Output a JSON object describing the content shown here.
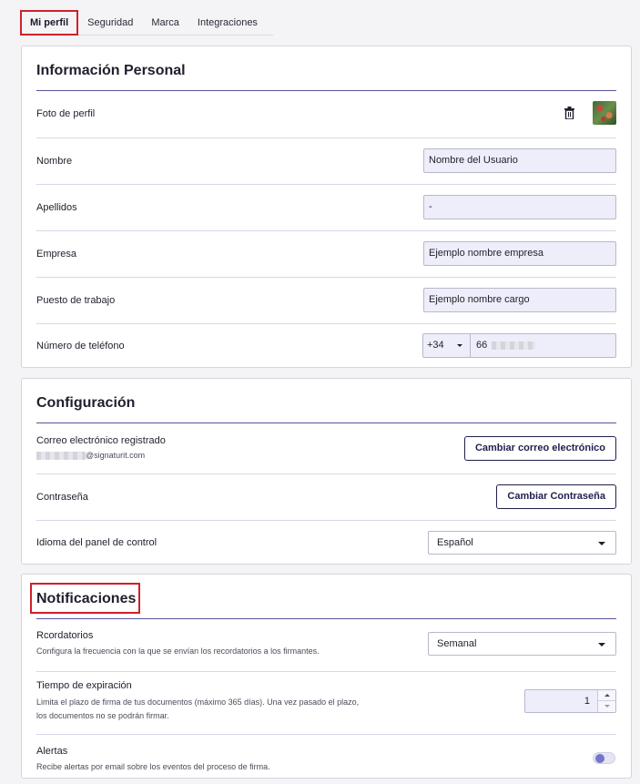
{
  "tabs": [
    "Mi perfil",
    "Seguridad",
    "Marca",
    "Integraciones"
  ],
  "personal": {
    "title": "Información Personal",
    "photo_label": "Foto de perfil",
    "name_label": "Nombre",
    "name_value": "Nombre del Usuario",
    "surname_label": "Apellidos",
    "surname_value": "-",
    "company_label": "Empresa",
    "company_value": "Ejemplo nombre empresa",
    "job_label": "Puesto de trabajo",
    "job_value": "Ejemplo nombre cargo",
    "phone_label": "Número de teléfono",
    "phone_prefix": "+34",
    "phone_value": "66"
  },
  "config": {
    "title": "Configuración",
    "email_label": "Correo electrónico registrado",
    "email_domain": "@signaturit.com",
    "email_button": "Cambiar correo electrónico",
    "password_label": "Contraseña",
    "password_button": "Cambiar Contraseña",
    "language_label": "Idioma del panel de control",
    "language_value": "Español"
  },
  "notifications": {
    "title": "Notificaciones",
    "reminders_label": "Rcordatorios",
    "reminders_desc": "Configura la frecuencia con la que se envían los recordatorios a los firmantes.",
    "reminders_value": "Semanal",
    "expiration_label": "Tiempo de expiración",
    "expiration_desc_1": "Limita el plazo de firma de tus documentos (máximo 365 días). Una vez pasado el plazo,",
    "expiration_desc_2": "los documentos no se podrán firmar.",
    "expiration_value": "1",
    "alerts_label": "Alertas",
    "alerts_desc": "Recibe alertas por email sobre los eventos del proceso de firma.",
    "alerts_enabled": false
  },
  "colors": {
    "accent": "#55559a",
    "highlight": "#d0202a",
    "toggle_knob": "#7575c8"
  }
}
